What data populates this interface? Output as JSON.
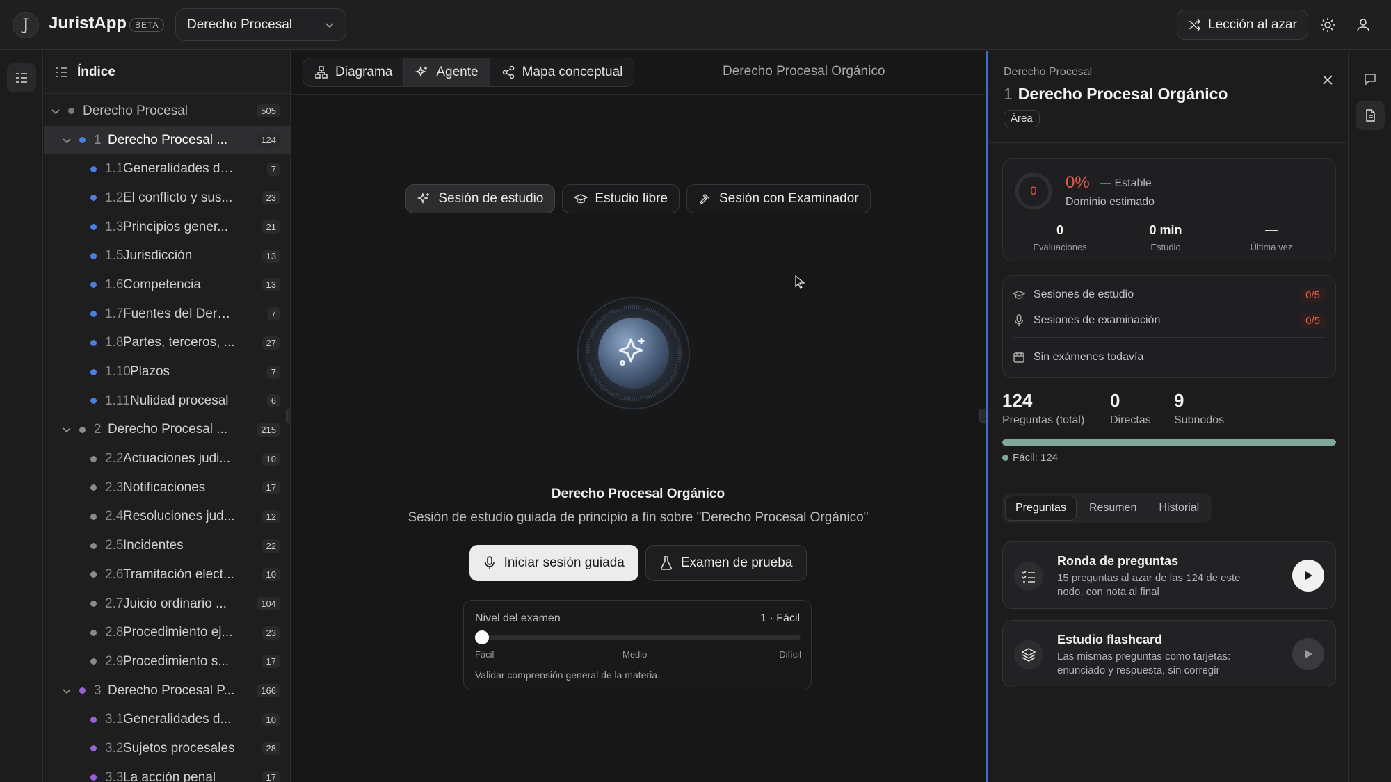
{
  "header": {
    "logo_letter": "J",
    "app_name": "JuristApp",
    "beta_label": "BETA",
    "subject_select": "Derecho Procesal",
    "random_lesson_label": "Lección al azar",
    "icons": [
      "shuffle-icon",
      "sun-icon",
      "user-icon",
      "chevron-down-icon"
    ]
  },
  "index": {
    "title": "Índice",
    "root": {
      "label": "Derecho Procesal",
      "count": "505"
    },
    "sections": [
      {
        "num": "1",
        "label": "Derecho Procesal ...",
        "count": "124",
        "color": "#4a7fe0",
        "selected": true,
        "children": [
          {
            "num": "1.1",
            "label": "Generalidades del...",
            "count": "7"
          },
          {
            "num": "1.2",
            "label": "El conflicto y sus...",
            "count": "23"
          },
          {
            "num": "1.3",
            "label": "Principios gener...",
            "count": "21"
          },
          {
            "num": "1.5",
            "label": "Jurisdicción",
            "count": "13"
          },
          {
            "num": "1.6",
            "label": "Competencia",
            "count": "13"
          },
          {
            "num": "1.7",
            "label": "Fuentes del Derec...",
            "count": "7"
          },
          {
            "num": "1.8",
            "label": "Partes, terceros, ...",
            "count": "27"
          },
          {
            "num": "1.10",
            "label": "Plazos",
            "count": "7"
          },
          {
            "num": "1.11",
            "label": "Nulidad procesal",
            "count": "6"
          }
        ]
      },
      {
        "num": "2",
        "label": "Derecho Procesal ...",
        "count": "215",
        "color": "#8a8a8e",
        "selected": false,
        "children": [
          {
            "num": "2.2",
            "label": "Actuaciones judi...",
            "count": "10"
          },
          {
            "num": "2.3",
            "label": "Notificaciones",
            "count": "17"
          },
          {
            "num": "2.4",
            "label": "Resoluciones jud...",
            "count": "12"
          },
          {
            "num": "2.5",
            "label": "Incidentes",
            "count": "22"
          },
          {
            "num": "2.6",
            "label": "Tramitación elect...",
            "count": "10"
          },
          {
            "num": "2.7",
            "label": "Juicio ordinario ...",
            "count": "104"
          },
          {
            "num": "2.8",
            "label": "Procedimiento ej...",
            "count": "23"
          },
          {
            "num": "2.9",
            "label": "Procedimiento s...",
            "count": "17"
          }
        ]
      },
      {
        "num": "3",
        "label": "Derecho Procesal P...",
        "count": "166",
        "color": "#9b5fd6",
        "selected": false,
        "children": [
          {
            "num": "3.1",
            "label": "Generalidades d...",
            "count": "10"
          },
          {
            "num": "3.2",
            "label": "Sujetos procesales",
            "count": "28"
          },
          {
            "num": "3.3",
            "label": "La acción penal",
            "count": "17"
          }
        ]
      }
    ]
  },
  "center": {
    "tabs": [
      {
        "label": "Diagrama",
        "icon": "diagram-icon",
        "active": false
      },
      {
        "label": "Agente",
        "icon": "sparkles-icon",
        "active": true
      },
      {
        "label": "Mapa conceptual",
        "icon": "share-nodes-icon",
        "active": false
      }
    ],
    "title": "Derecho Procesal Orgánico",
    "modes": [
      {
        "label": "Sesión de estudio",
        "icon": "sparkles-icon",
        "active": true
      },
      {
        "label": "Estudio libre",
        "icon": "graduation-cap-icon",
        "active": false
      },
      {
        "label": "Sesión con Examinador",
        "icon": "gavel-icon",
        "active": false
      }
    ],
    "session_title": "Derecho Procesal Orgánico",
    "session_desc": "Sesión de estudio guiada de principio a fin sobre \"Derecho Procesal Orgánico\"",
    "start_button": "Iniciar sesión guiada",
    "exam_button": "Examen de prueba",
    "exam_level": {
      "label": "Nivel del examen",
      "value": "1 · Fácil",
      "position": 0,
      "ticks": [
        "Fácil",
        "Medio",
        "Difícil"
      ],
      "note": "Validar comprensión general de la materia."
    }
  },
  "detail": {
    "breadcrumb": "Derecho Procesal",
    "number": "1",
    "title": "Derecho Procesal Orgánico",
    "badge": "Área",
    "mastery": {
      "ring_value": "0",
      "percent": "0%",
      "trend": "— Estable",
      "label": "Dominio estimado",
      "stats": [
        {
          "value": "0",
          "label": "Evaluaciones"
        },
        {
          "value": "0 min",
          "label": "Estudio"
        },
        {
          "value": "—",
          "label": "Última vez"
        }
      ]
    },
    "sessions": [
      {
        "label": "Sesiones de estudio",
        "ratio": "0/5",
        "icon": "graduation-cap-icon"
      },
      {
        "label": "Sesiones de examinación",
        "ratio": "0/5",
        "icon": "microphone-icon"
      }
    ],
    "no_exams": "Sin exámenes todavía",
    "counts": [
      {
        "value": "124",
        "label": "Preguntas (total)"
      },
      {
        "value": "0",
        "label": "Directas"
      },
      {
        "value": "9",
        "label": "Subnodos"
      }
    ],
    "easy_fraction": 1.0,
    "easy_legend": "Fácil: 124",
    "tabs": [
      {
        "label": "Preguntas",
        "active": true
      },
      {
        "label": "Resumen",
        "active": false
      },
      {
        "label": "Historial",
        "active": false
      }
    ],
    "actions": [
      {
        "title": "Ronda de preguntas",
        "desc": "15 preguntas al azar de las 124 de este nodo, con nota al final",
        "icon": "list-check-icon",
        "enabled": true
      },
      {
        "title": "Estudio flashcard",
        "desc": "Las mismas preguntas como tarjetas: enunciado y respuesta, sin corregir",
        "icon": "layers-icon",
        "enabled": false
      }
    ]
  },
  "colors": {
    "accent_blue": "#4a7fe0",
    "danger": "#e25a4b",
    "easy": "#7fa79a"
  }
}
